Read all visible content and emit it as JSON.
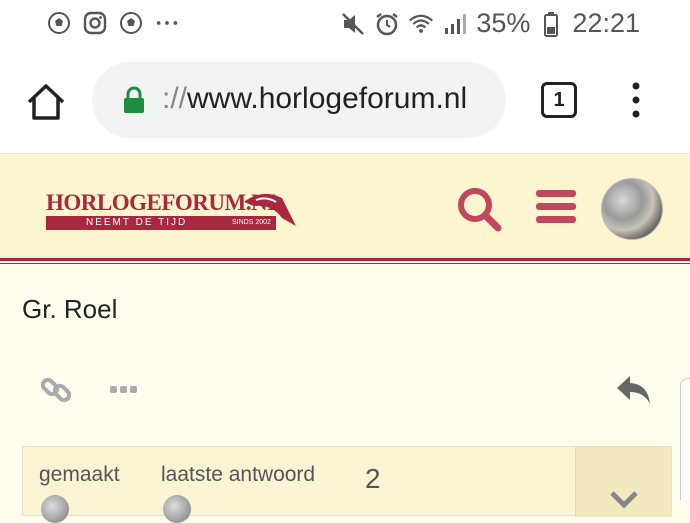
{
  "status_bar": {
    "left_icons": [
      "soccer-ball-icon",
      "instagram-icon",
      "soccer-ball-icon",
      "more-notifications-icon"
    ],
    "right_icons": [
      "mute-icon",
      "alarm-icon",
      "wifi-icon",
      "signal-icon"
    ],
    "battery": "35%",
    "time": "22:21"
  },
  "browser": {
    "url_scheme": "://",
    "url_host": "www.horlogeforum.nl",
    "tab_count": "1",
    "home_icon": "home-icon",
    "lock_icon": "lock-icon",
    "menu_icon": "vertical-dots-icon"
  },
  "site_header": {
    "logo_title": "HORLOGEFORUM.NL",
    "logo_tagline": "NEEMT DE TIJD",
    "logo_since": "SINDS 2002",
    "accent_color": "#a8283f",
    "background_color": "#fdf4d0"
  },
  "post": {
    "text": "Gr. Roel"
  },
  "topic_map": {
    "created_label": "gemaakt",
    "last_reply_label": "laatste antwoord",
    "reply_count": "2"
  }
}
